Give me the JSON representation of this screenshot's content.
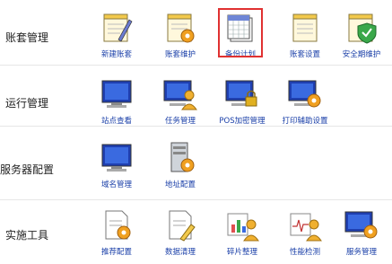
{
  "sections": [
    {
      "title": "账套管理",
      "items": [
        {
          "label": "新建账套",
          "icon": "notepad-pencil-icon"
        },
        {
          "label": "账套维护",
          "icon": "calendar-gear-icon"
        },
        {
          "label": "备份计划",
          "icon": "calendar-backup-icon"
        },
        {
          "label": "账套设置",
          "icon": "notepad-icon"
        },
        {
          "label": "安全期维护",
          "icon": "shield-check-icon"
        }
      ]
    },
    {
      "title": "运行管理",
      "items": [
        {
          "label": "站点查看",
          "icon": "monitor-icon"
        },
        {
          "label": "任务管理",
          "icon": "monitor-user-icon"
        },
        {
          "label": "POS加密管理",
          "icon": "monitor-lock-icon"
        },
        {
          "label": "打印辅助设置",
          "icon": "monitor-gear-icon"
        }
      ]
    },
    {
      "title": "服务器配置",
      "items": [
        {
          "label": "域名管理",
          "icon": "monitor-icon"
        },
        {
          "label": "地址配置",
          "icon": "server-gear-icon"
        }
      ]
    },
    {
      "title": "实施工具",
      "items": [
        {
          "label": "推荐配置",
          "icon": "document-gear-icon"
        },
        {
          "label": "数据清理",
          "icon": "document-clean-icon"
        },
        {
          "label": "碎片整理",
          "icon": "chart-user-icon"
        },
        {
          "label": "性能检测",
          "icon": "pulse-user-icon"
        },
        {
          "label": "服务管理",
          "icon": "monitor-gear-icon"
        }
      ]
    }
  ],
  "colors": {
    "label": "#1a3fa8",
    "highlight": "#e03131"
  }
}
